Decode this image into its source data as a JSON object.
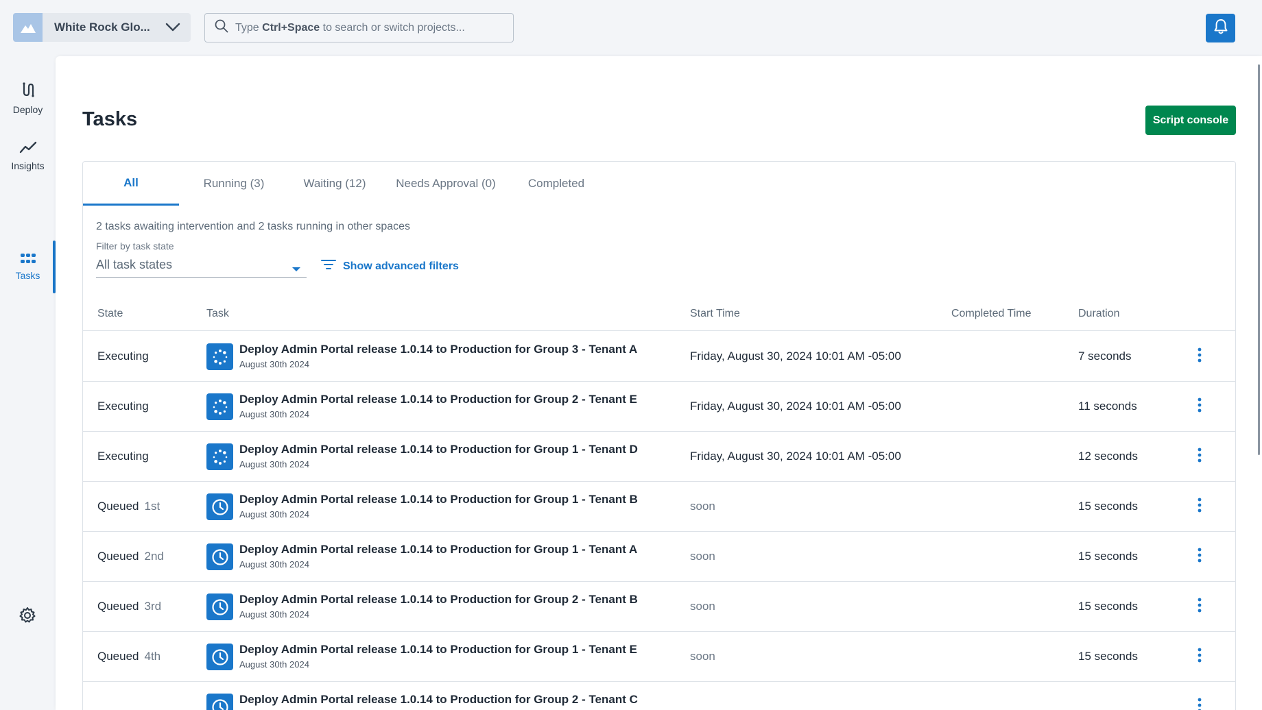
{
  "header": {
    "space_name": "White Rock Glo...",
    "search_placeholder_pre": "Type ",
    "search_placeholder_key": "Ctrl+Space",
    "search_placeholder_post": " to search or switch projects..."
  },
  "nav": {
    "items": [
      {
        "label": "Deploy",
        "icon": "deploy-icon"
      },
      {
        "label": "Insights",
        "icon": "insights-chart-icon"
      },
      {
        "label": "Tasks",
        "icon": "tasks-grid-icon",
        "active": true
      }
    ]
  },
  "page": {
    "title": "Tasks",
    "script_console_label": "Script console",
    "tabs": [
      {
        "label": "All",
        "active": true
      },
      {
        "label": "Running (3)"
      },
      {
        "label": "Waiting (12)"
      },
      {
        "label": "Needs Approval (0)"
      },
      {
        "label": "Completed"
      }
    ],
    "summary": "2 tasks awaiting intervention and 2 tasks running in other spaces",
    "filter_label": "Filter by task state",
    "filter_value": "All task states",
    "advanced_filters_label": "Show advanced filters"
  },
  "table": {
    "columns": {
      "state": "State",
      "task": "Task",
      "start": "Start Time",
      "completed": "Completed Time",
      "duration": "Duration"
    },
    "rows": [
      {
        "state": "Executing",
        "position": "",
        "icon": "executing-spinner-icon",
        "task": "Deploy Admin Portal release 1.0.14 to Production for Group 3 - Tenant A",
        "date": "August 30th 2024",
        "start": "Friday, August 30, 2024 10:01 AM -05:00",
        "completed": "",
        "duration": "7 seconds"
      },
      {
        "state": "Executing",
        "position": "",
        "icon": "executing-spinner-icon",
        "task": "Deploy Admin Portal release 1.0.14 to Production for Group 2 - Tenant E",
        "date": "August 30th 2024",
        "start": "Friday, August 30, 2024 10:01 AM -05:00",
        "completed": "",
        "duration": "11 seconds"
      },
      {
        "state": "Executing",
        "position": "",
        "icon": "executing-spinner-icon",
        "task": "Deploy Admin Portal release 1.0.14 to Production for Group 1 - Tenant D",
        "date": "August 30th 2024",
        "start": "Friday, August 30, 2024 10:01 AM -05:00",
        "completed": "",
        "duration": "12 seconds"
      },
      {
        "state": "Queued",
        "position": "1st",
        "icon": "queued-clock-icon",
        "task": "Deploy Admin Portal release 1.0.14 to Production for Group 1 - Tenant B",
        "date": "August 30th 2024",
        "start": "soon",
        "completed": "",
        "duration": "15 seconds"
      },
      {
        "state": "Queued",
        "position": "2nd",
        "icon": "queued-clock-icon",
        "task": "Deploy Admin Portal release 1.0.14 to Production for Group 1 - Tenant A",
        "date": "August 30th 2024",
        "start": "soon",
        "completed": "",
        "duration": "15 seconds"
      },
      {
        "state": "Queued",
        "position": "3rd",
        "icon": "queued-clock-icon",
        "task": "Deploy Admin Portal release 1.0.14 to Production for Group 2 - Tenant B",
        "date": "August 30th 2024",
        "start": "soon",
        "completed": "",
        "duration": "15 seconds"
      },
      {
        "state": "Queued",
        "position": "4th",
        "icon": "queued-clock-icon",
        "task": "Deploy Admin Portal release 1.0.14 to Production for Group 1 - Tenant E",
        "date": "August 30th 2024",
        "start": "soon",
        "completed": "",
        "duration": "15 seconds"
      },
      {
        "state": "",
        "position": "",
        "icon": "queued-clock-icon",
        "task": "Deploy Admin Portal release 1.0.14 to Production for Group 2 - Tenant C",
        "date": "",
        "start": "",
        "completed": "",
        "duration": ""
      }
    ]
  },
  "colors": {
    "accent": "#1a77ca",
    "primary_action": "#00874f",
    "background": "#f3f5f8"
  }
}
